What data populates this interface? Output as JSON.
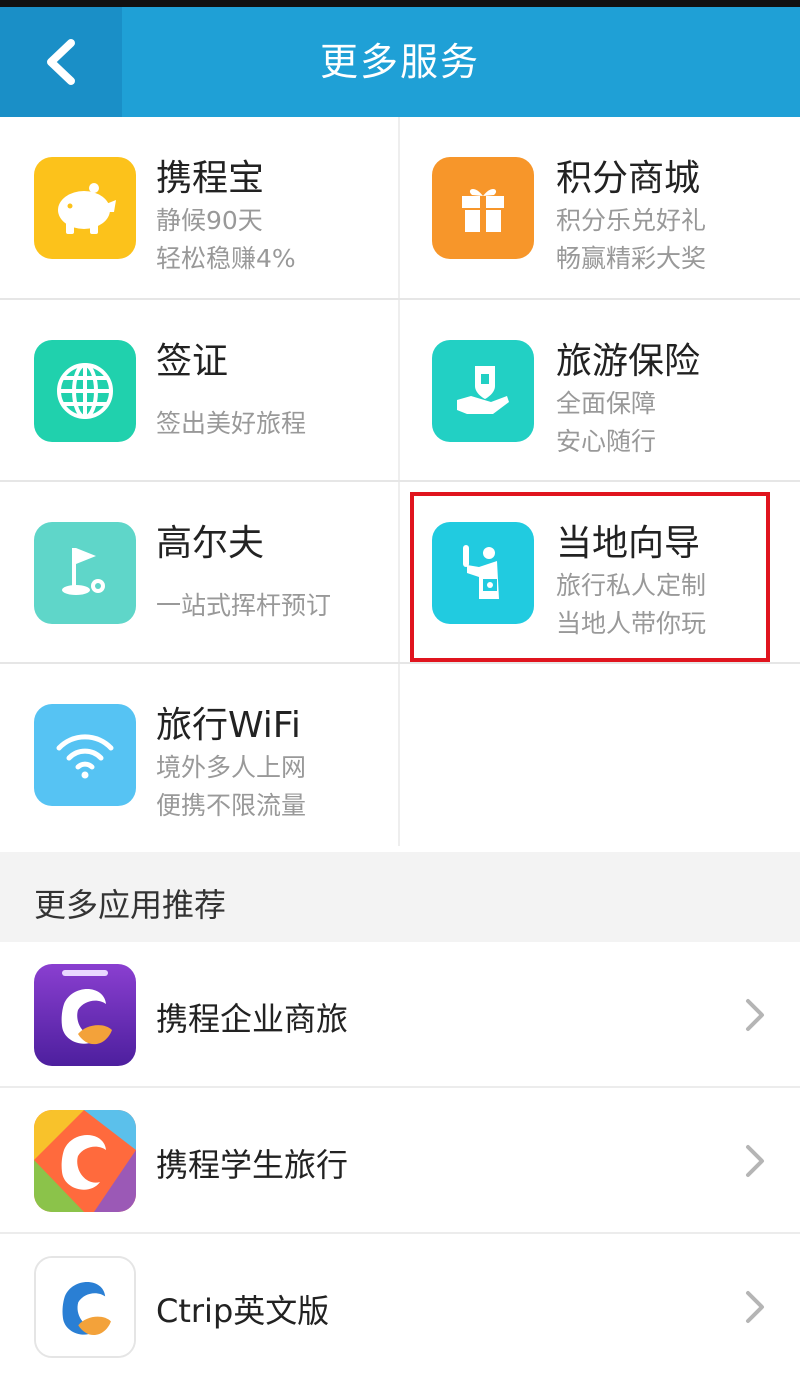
{
  "header": {
    "title": "更多服务",
    "back_icon": "back-arrow-icon"
  },
  "services": [
    {
      "title": "携程宝",
      "lines": [
        "静候90天",
        "轻松稳赚4%"
      ],
      "icon": "piggy-bank-icon",
      "color": "#fcc21b"
    },
    {
      "title": "积分商城",
      "lines": [
        "积分乐兑好礼",
        "畅赢精彩大奖"
      ],
      "icon": "gift-icon",
      "color": "#f7962a"
    },
    {
      "title": "签证",
      "lines": [
        "签出美好旅程"
      ],
      "icon": "globe-icon",
      "color": "#20d1ad"
    },
    {
      "title": "旅游保险",
      "lines": [
        "全面保障",
        "安心随行"
      ],
      "icon": "shield-hand-icon",
      "color": "#22d0c4"
    },
    {
      "title": "高尔夫",
      "lines": [
        "一站式挥杆预订"
      ],
      "icon": "golf-flag-icon",
      "color": "#5fd6c9"
    },
    {
      "title": "当地向导",
      "lines": [
        "旅行私人定制",
        "当地人带你玩"
      ],
      "icon": "guide-person-icon",
      "color": "#21cbe0"
    },
    {
      "title": "旅行WiFi",
      "lines": [
        "境外多人上网",
        "便携不限流量"
      ],
      "icon": "wifi-icon",
      "color": "#56c3f3"
    }
  ],
  "recommend": {
    "title": "更多应用推荐",
    "apps": [
      {
        "label": "携程企业商旅",
        "icon": "ctrip-business-app-icon"
      },
      {
        "label": "携程学生旅行",
        "icon": "ctrip-student-app-icon"
      },
      {
        "label": "Ctrip英文版",
        "icon": "ctrip-english-app-icon"
      }
    ]
  },
  "colors": {
    "header": "#1fa0d6",
    "back": "#1a8fc7",
    "highlight": "#e0141e"
  }
}
